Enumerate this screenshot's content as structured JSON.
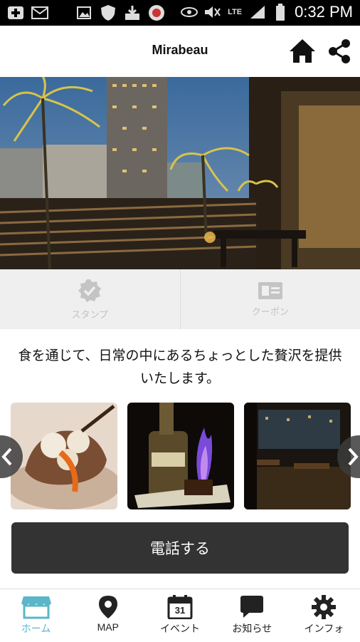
{
  "status_bar": {
    "time": "0:32 PM",
    "network": "LTE"
  },
  "header": {
    "title": "Mirabeau"
  },
  "tiles": [
    {
      "label": "スタンプ",
      "icon": "check-badge-icon"
    },
    {
      "label": "クーポン",
      "icon": "coupon-card-icon"
    }
  ],
  "tagline": "食を通じて、日常の中にあるちょっとした贅沢を提供いたします。",
  "gallery": {
    "items": [
      "dessert-photo",
      "flambe-drink-photo",
      "interior-photo"
    ]
  },
  "call_button": {
    "label": "電話する"
  },
  "bottom_nav": [
    {
      "label": "ホーム",
      "icon": "storefront-icon",
      "active": true
    },
    {
      "label": "MAP",
      "icon": "map-pin-icon"
    },
    {
      "label": "イベント",
      "icon": "calendar-icon",
      "calendar_day": "31"
    },
    {
      "label": "お知らせ",
      "icon": "speech-bubble-icon"
    },
    {
      "label": "インフォ",
      "icon": "gear-icon"
    }
  ],
  "colors": {
    "accent": "#5ab6c9",
    "button_bg": "#333333",
    "tile_bg": "#efefef"
  }
}
